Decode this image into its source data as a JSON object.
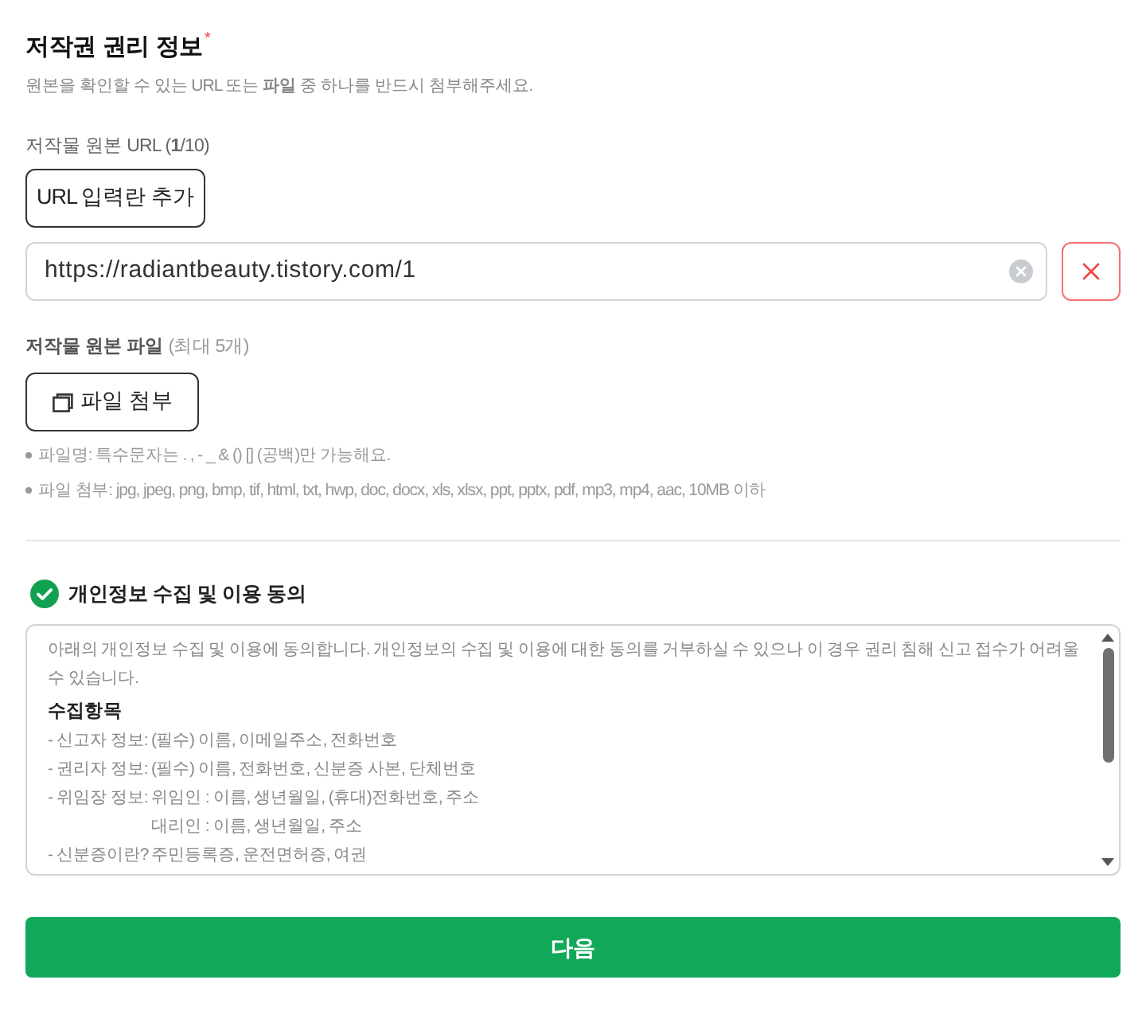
{
  "section": {
    "title": "저작권 권리 정보",
    "required_mark": "*",
    "description": "원본을 확인할 수 있는 URL 또는 **파일** 중 하나를 반드시 첨부해주세요."
  },
  "url_group": {
    "label": "저작물 원본 URL (**1**/10)",
    "add_button": "URL 입력란 추가",
    "inputs": [
      {
        "value": "https://radiantbeauty.tistory.com/1"
      }
    ]
  },
  "file_group": {
    "label": "저작물 원본 파일",
    "hint": "(최대 5개)",
    "attach_button": "파일 첨부",
    "notes": [
      "파일명: 특수문자는 . , - _ & () [] (공백)만 가능해요.",
      "파일 첨부: jpg, jpeg, png, bmp, tif, html, txt, hwp, doc, docx, xls, xlsx, ppt, pptx, pdf, mp3, mp4, aac, 10MB 이하"
    ]
  },
  "consent": {
    "title": "개인정보 수집 및 이용 동의",
    "checked": true,
    "intro": "아래의 개인정보 수집 및 이용에 동의합니다. 개인정보의 수집 및 이용에 대한 동의를 거부하실 수 있으나 이 경우 권리 침해 신고 접수가 어려울 수 있습니다.",
    "heading": "수집항목",
    "items": [
      {
        "label": "- 신고자 정보:",
        "lines": [
          "(필수) 이름, 이메일주소, 전화번호"
        ]
      },
      {
        "label": "- 권리자 정보:",
        "lines": [
          "(필수) 이름, 전화번호, 신분증 사본, 단체번호"
        ]
      },
      {
        "label": "- 위임장 정보:",
        "lines": [
          "위임인 : 이름, 생년월일, (휴대)전화번호, 주소",
          "대리인 : 이름, 생년월일, 주소"
        ]
      },
      {
        "label": "- 신분증이란?",
        "lines": [
          "주민등록증, 운전면허증, 여권"
        ]
      }
    ]
  },
  "next_button": "다음"
}
